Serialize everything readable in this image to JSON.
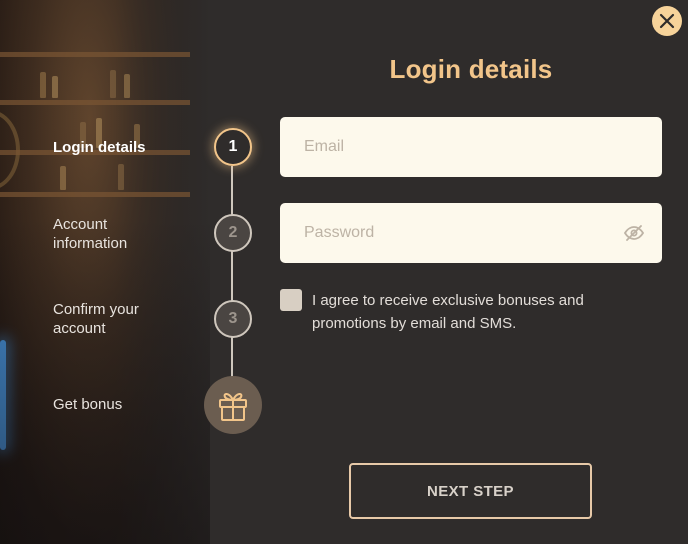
{
  "title": "Login details",
  "steps": [
    {
      "label": "Login details",
      "number": "1",
      "state": "active"
    },
    {
      "label": "Account information",
      "number": "2",
      "state": "inactive"
    },
    {
      "label": "Confirm your account",
      "number": "3",
      "state": "inactive"
    },
    {
      "label": "Get bonus",
      "icon": "gift-icon",
      "state": "inactive"
    }
  ],
  "form": {
    "email_placeholder": "Email",
    "email_value": "",
    "password_placeholder": "Password",
    "password_value": "",
    "consent_text": "I agree to receive exclusive bonuses and promotions by email and SMS.",
    "consent_checked": false
  },
  "next_button_label": "NEXT STEP",
  "icons": {
    "close": "close-icon",
    "password_toggle": "eye-off-icon",
    "bonus": "gift-icon"
  },
  "colors": {
    "background": "#2f2c2b",
    "accent": "#f2c58a",
    "input_bg": "#fdf9ec"
  }
}
